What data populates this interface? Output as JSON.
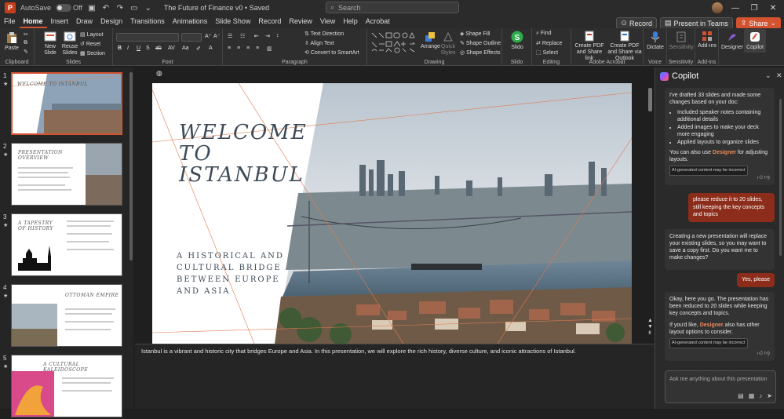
{
  "titlebar": {
    "autosave_label": "AutoSave",
    "autosave_state": "Off",
    "doc_title": "The Future of Finance v0 • Saved",
    "search_placeholder": "Search"
  },
  "tabs": [
    "File",
    "Home",
    "Insert",
    "Draw",
    "Design",
    "Transitions",
    "Animations",
    "Slide Show",
    "Record",
    "Review",
    "View",
    "Help",
    "Acrobat"
  ],
  "active_tab": "Home",
  "tab_actions": {
    "record": "Record",
    "present": "Present in Teams",
    "share": "Share"
  },
  "ribbon": {
    "clipboard": {
      "paste": "Paste",
      "label": "Clipboard"
    },
    "slides": {
      "new_slide": "New Slide",
      "reuse_slides": "Reuse Slides",
      "layout": "Layout",
      "reset": "Reset",
      "section": "Section",
      "label": "Slides"
    },
    "font": {
      "label": "Font"
    },
    "paragraph": {
      "text_direction": "Text Direction",
      "align_text": "Align Text",
      "convert_smartart": "Convert to SmartArt",
      "label": "Paragraph"
    },
    "drawing": {
      "arrange": "Arrange",
      "quick_styles": "Quick Styles",
      "shape_fill": "Shape Fill",
      "shape_outline": "Shape Outline",
      "shape_effects": "Shape Effects",
      "label": "Drawing"
    },
    "slido": {
      "button": "Slido",
      "label": "Slido"
    },
    "editing": {
      "find": "Find",
      "replace": "Replace",
      "select": "Select",
      "label": "Editing"
    },
    "acrobat": {
      "create_share": "Create PDF and Share link",
      "create_outlook": "Create PDF and Share via Outlook",
      "label": "Adobe Acrobat"
    },
    "voice": {
      "dictate": "Dictate",
      "label": "Voice"
    },
    "sensitivity": {
      "button": "Sensitivity",
      "label": "Sensitivity"
    },
    "addins": {
      "button": "Add-ins",
      "label": "Add-ins"
    },
    "designer": "Designer",
    "copilot": "Copilot"
  },
  "thumbnails": [
    {
      "num": "1",
      "title": "WELCOME TO ISTANBUL",
      "subtitle": "A HISTORICAL AND CULTURAL BRIDGE BETWEEN EUROPE AND ASIA"
    },
    {
      "num": "2",
      "title": "PRESENTATION OVERVIEW"
    },
    {
      "num": "3",
      "title": "A TAPESTRY OF HISTORY"
    },
    {
      "num": "4",
      "title": "OTTOMAN EMPIRE"
    },
    {
      "num": "5",
      "title": "A CULTURAL KALEIDOSCOPE"
    }
  ],
  "slide": {
    "title": "WELCOME\nTO\nISTANBUL",
    "subtitle": "A HISTORICAL AND\nCULTURAL BRIDGE\nBETWEEN EUROPE\nAND ASIA"
  },
  "notes": "Istanbul is a vibrant and historic city that bridges Europe and Asia. In this presentation, we will explore the rich history, diverse culture, and iconic attractions of Istanbul.",
  "copilot": {
    "title": "Copilot",
    "msg1_intro": "I've drafted 33 slides and made some changes based on your doc:",
    "msg1_bullets": [
      "Included speaker notes containing additional details",
      "Added images to make your deck more engaging",
      "Applied layouts to organize slides"
    ],
    "msg1_outro_a": "You can also use ",
    "msg1_outro_link": "Designer",
    "msg1_outro_b": " for adjusting layouts.",
    "ai_tag": "AI-generated content may be incorrect",
    "user1": "please reduce it to 20 slides, still keeping the key concepts and topics",
    "msg2": "Creating a new presentation will replace your existing slides, so you may want to save a copy first. Do you want me to make changes?",
    "user2": "Yes, please",
    "msg3_a": "Okay, here you go. The presentation has been reduced to 20 slides while keeping key concepts and topics.",
    "msg3_b1": "If you'd like, ",
    "msg3_link": "Designer",
    "msg3_b2": " also has other layout options to consider.",
    "input_placeholder": "Ask me anything about this presentation"
  },
  "colors": {
    "accent": "#d35230",
    "user_bubble": "#8b2d1a",
    "slide_text": "#3d4a57",
    "slide_lines": "#e07b4f"
  }
}
